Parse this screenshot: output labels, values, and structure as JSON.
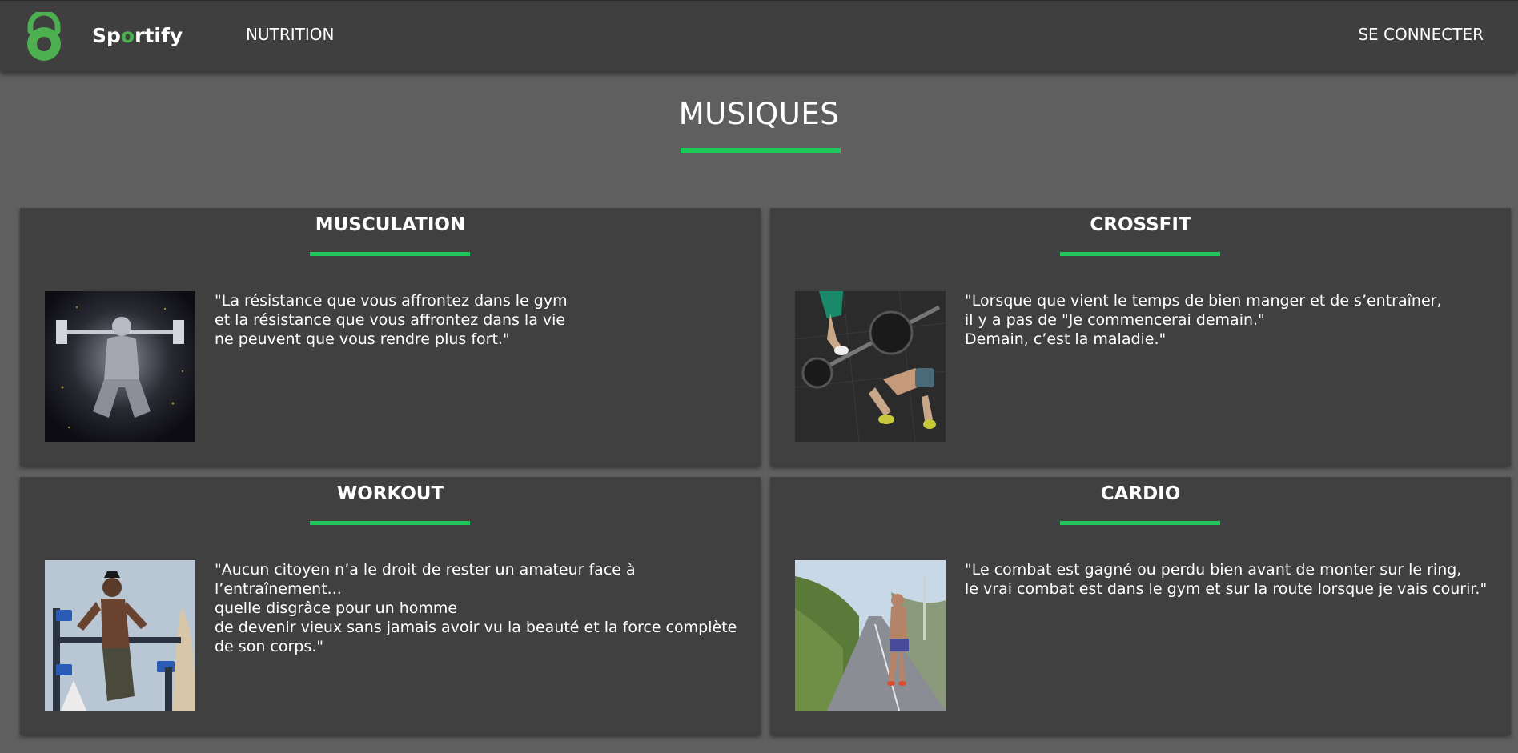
{
  "nav": {
    "logo_text_pre": "Sp",
    "logo_text_accent": "o",
    "logo_text_post": "rtify",
    "logo_icon": "kettlebell-icon",
    "links": [
      {
        "label": "NUTRITION"
      },
      {
        "label": "SE CONNECTER"
      }
    ]
  },
  "page": {
    "title": "MUSIQUES"
  },
  "colors": {
    "accent": "#1ec85a",
    "logo_green": "#4caf50",
    "navbar_bg": "#3f3f3f",
    "page_bg": "#5f5f5f",
    "card_bg": "#404040"
  },
  "cards": [
    {
      "title": "MUSCULATION",
      "quote_lines": [
        "\"La résistance que vous affrontez dans le gym",
        "et la résistance que vous affrontez dans la vie",
        "ne peuvent que vous rendre plus fort.\""
      ]
    },
    {
      "title": "CROSSFIT",
      "quote_lines": [
        "\"Lorsque que vient le temps de bien manger et de s’entraîner,",
        "il y a pas de \"Je commencerai demain.\"",
        "Demain, c’est la maladie.\""
      ]
    },
    {
      "title": "WORKOUT",
      "quote_lines": [
        "\"Aucun citoyen n’a le droit de rester un amateur face à",
        "l’entraînement...",
        "quelle disgrâce pour un homme",
        "de devenir vieux sans jamais avoir vu la beauté et la force complète",
        "de son corps.\""
      ]
    },
    {
      "title": "CARDIO",
      "quote_lines": [
        "\"Le combat est gagné ou perdu bien avant de monter sur le ring,",
        "le vrai combat est dans le gym et sur la route lorsque je vais courir.\""
      ]
    }
  ]
}
